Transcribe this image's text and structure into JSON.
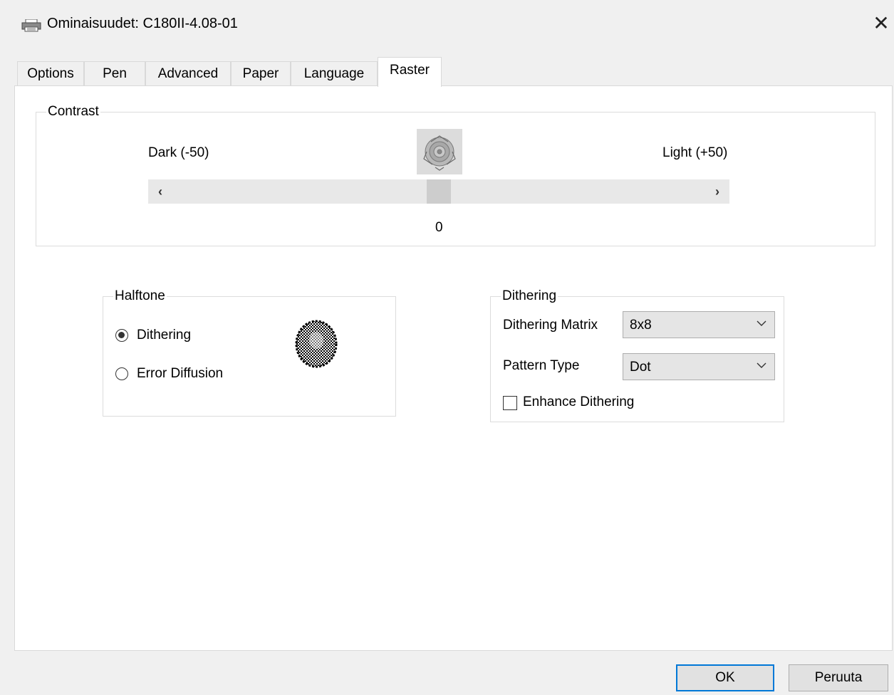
{
  "window": {
    "title": "Ominaisuudet: C180II-4.08-01",
    "close_label": "✕"
  },
  "tabs": [
    {
      "label": "Options",
      "active": false
    },
    {
      "label": "Pen",
      "active": false
    },
    {
      "label": "Advanced",
      "active": false
    },
    {
      "label": "Paper",
      "active": false
    },
    {
      "label": "Language",
      "active": false
    },
    {
      "label": "Raster",
      "active": true
    }
  ],
  "contrast": {
    "legend": "Contrast",
    "min_label": "Dark (-50)",
    "max_label": "Light (+50)",
    "value_label": "0",
    "value": 0,
    "min": -50,
    "max": 50,
    "left_arrow": "‹",
    "right_arrow": "›"
  },
  "halftone": {
    "legend": "Halftone",
    "options": [
      {
        "label": "Dithering",
        "checked": true
      },
      {
        "label": "Error Diffusion",
        "checked": false
      }
    ]
  },
  "dithering": {
    "legend": "Dithering",
    "matrix_label": "Dithering Matrix",
    "matrix_value": "8x8",
    "pattern_label": "Pattern Type",
    "pattern_value": "Dot",
    "enhance_label": "Enhance Dithering",
    "enhance_checked": false
  },
  "buttons": {
    "ok": "OK",
    "cancel": "Peruuta"
  },
  "colors": {
    "accent": "#0078d7",
    "panel": "#ffffff",
    "background": "#f0f0f0"
  }
}
